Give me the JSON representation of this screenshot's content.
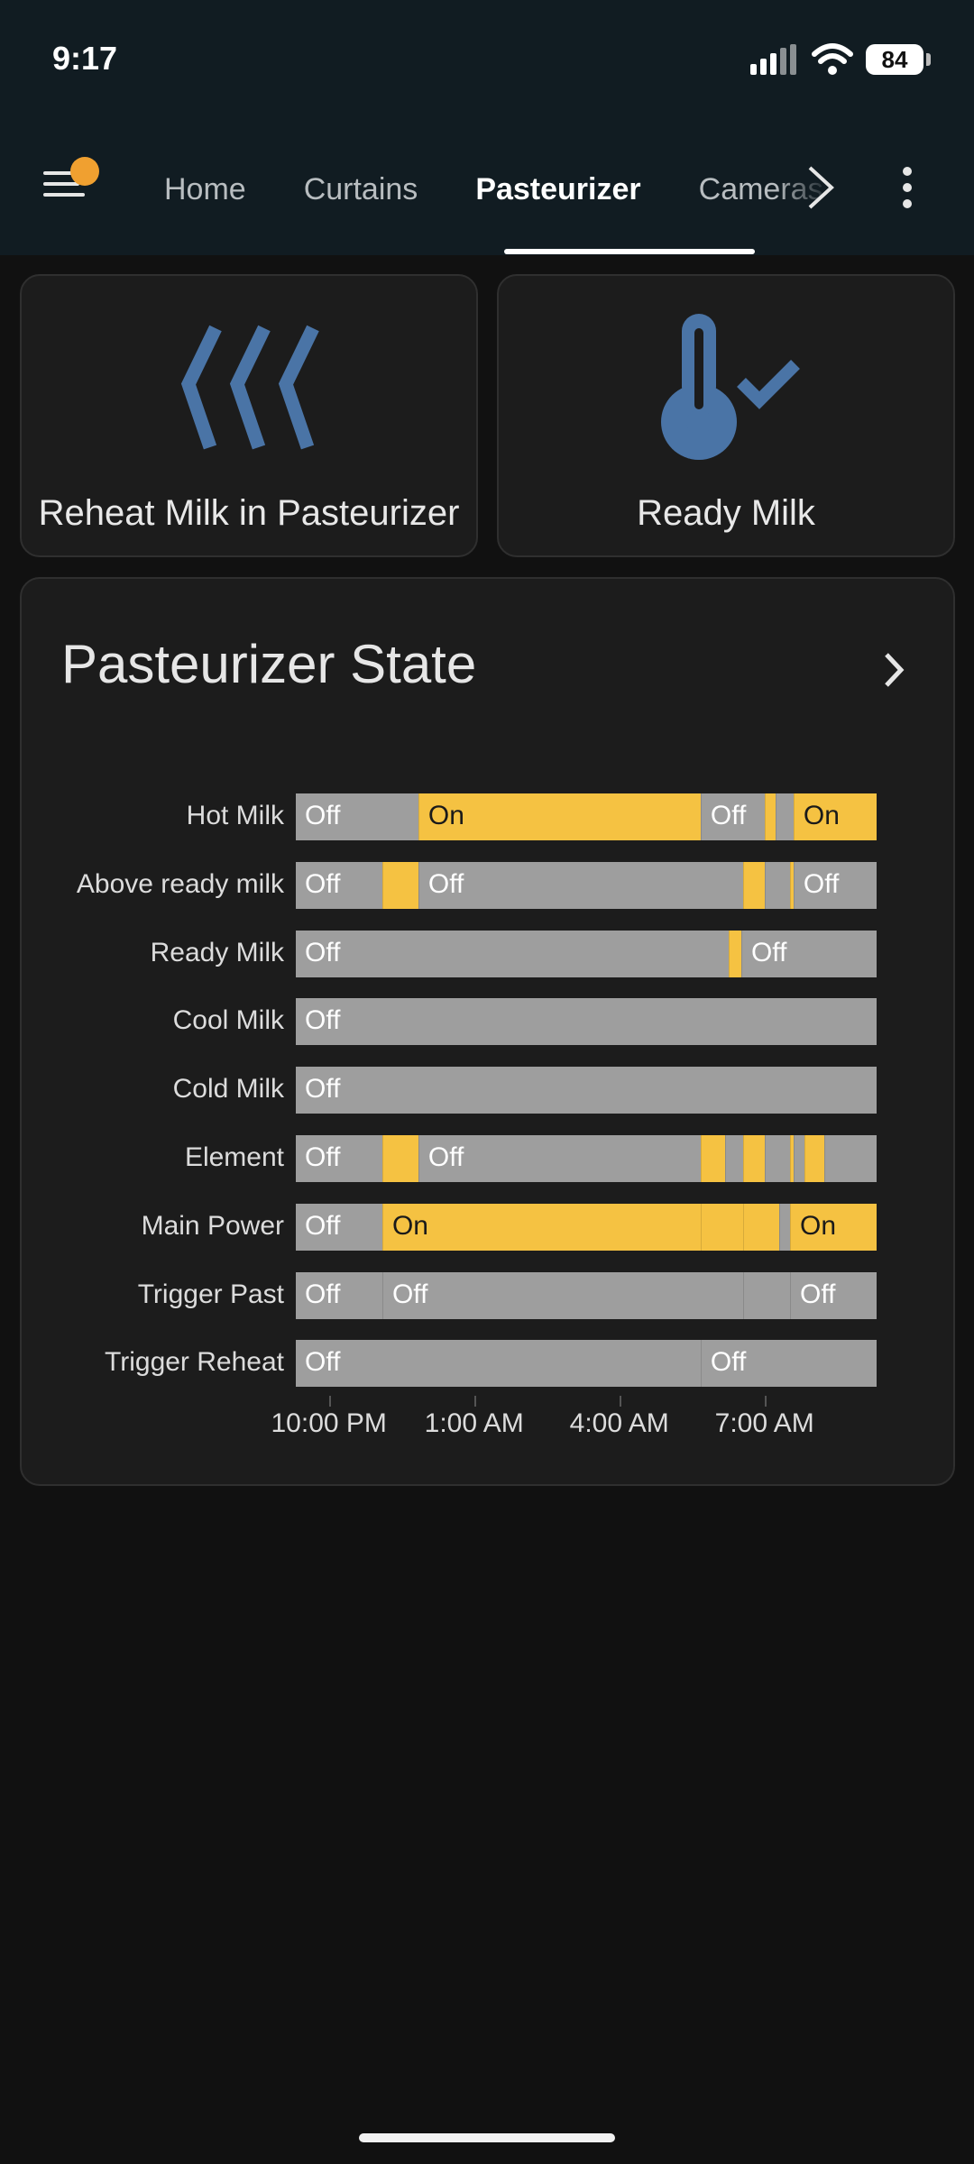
{
  "status_bar": {
    "time": "9:17",
    "battery": "84"
  },
  "nav": {
    "tabs": [
      {
        "label": "Home",
        "active": false
      },
      {
        "label": "Curtains",
        "active": false
      },
      {
        "label": "Pasteurizer",
        "active": true
      },
      {
        "label": "Cameras",
        "active": false
      }
    ]
  },
  "tiles": [
    {
      "label": "Reheat Milk in Pasteurizer",
      "icon": "heat-wave-icon"
    },
    {
      "label": "Ready Milk",
      "icon": "thermometer-check-icon"
    }
  ],
  "colors": {
    "on": "#f5c242",
    "off": "#9e9e9e",
    "icon_blue": "#4a74a6",
    "accent_dot": "#f0a030"
  },
  "history": {
    "title": "Pasteurizer State",
    "x_ticks": [
      {
        "label": "10:00 PM",
        "frac": 0.057
      },
      {
        "label": "1:00 AM",
        "frac": 0.307
      },
      {
        "label": "4:00 AM",
        "frac": 0.557
      },
      {
        "label": "7:00 AM",
        "frac": 0.807
      }
    ],
    "rows": [
      {
        "name": "Hot Milk",
        "segments": [
          {
            "state": "off",
            "start": 0.0,
            "end": 0.211,
            "label": "Off"
          },
          {
            "state": "on",
            "start": 0.211,
            "end": 0.697,
            "label": "On"
          },
          {
            "state": "off",
            "start": 0.697,
            "end": 0.807,
            "label": "Off"
          },
          {
            "state": "on",
            "start": 0.807,
            "end": 0.826
          },
          {
            "state": "off",
            "start": 0.826,
            "end": 0.857
          },
          {
            "state": "on",
            "start": 0.857,
            "end": 1.0,
            "label": "On"
          }
        ]
      },
      {
        "name": "Above ready milk",
        "segments": [
          {
            "state": "off",
            "start": 0.0,
            "end": 0.149,
            "label": "Off"
          },
          {
            "state": "on",
            "start": 0.149,
            "end": 0.211
          },
          {
            "state": "off",
            "start": 0.211,
            "end": 0.77,
            "label": "Off"
          },
          {
            "state": "on",
            "start": 0.77,
            "end": 0.807
          },
          {
            "state": "off",
            "start": 0.807,
            "end": 0.851
          },
          {
            "state": "on",
            "start": 0.851,
            "end": 0.857
          },
          {
            "state": "off",
            "start": 0.857,
            "end": 1.0,
            "label": "Off"
          }
        ]
      },
      {
        "name": "Ready Milk",
        "segments": [
          {
            "state": "off",
            "start": 0.0,
            "end": 0.745,
            "label": "Off"
          },
          {
            "state": "on",
            "start": 0.745,
            "end": 0.767
          },
          {
            "state": "off",
            "start": 0.767,
            "end": 1.0,
            "label": "Off"
          }
        ]
      },
      {
        "name": "Cool Milk",
        "segments": [
          {
            "state": "off",
            "start": 0.0,
            "end": 1.0,
            "label": "Off"
          }
        ]
      },
      {
        "name": "Cold Milk",
        "segments": [
          {
            "state": "off",
            "start": 0.0,
            "end": 1.0,
            "label": "Off"
          }
        ]
      },
      {
        "name": "Element",
        "segments": [
          {
            "state": "off",
            "start": 0.0,
            "end": 0.149,
            "label": "Off"
          },
          {
            "state": "on",
            "start": 0.149,
            "end": 0.211
          },
          {
            "state": "off",
            "start": 0.211,
            "end": 0.697,
            "label": "Off"
          },
          {
            "state": "on",
            "start": 0.697,
            "end": 0.739
          },
          {
            "state": "off",
            "start": 0.739,
            "end": 0.77
          },
          {
            "state": "on",
            "start": 0.77,
            "end": 0.807
          },
          {
            "state": "off",
            "start": 0.807,
            "end": 0.851
          },
          {
            "state": "on",
            "start": 0.851,
            "end": 0.857
          },
          {
            "state": "off",
            "start": 0.857,
            "end": 0.876
          },
          {
            "state": "on",
            "start": 0.876,
            "end": 0.91
          },
          {
            "state": "off",
            "start": 0.91,
            "end": 1.0
          }
        ]
      },
      {
        "name": "Main Power",
        "segments": [
          {
            "state": "off",
            "start": 0.0,
            "end": 0.149,
            "label": "Off"
          },
          {
            "state": "on",
            "start": 0.149,
            "end": 0.697,
            "label": "On"
          },
          {
            "state": "on",
            "start": 0.697,
            "end": 0.77
          },
          {
            "state": "on",
            "start": 0.77,
            "end": 0.832
          },
          {
            "state": "off",
            "start": 0.832,
            "end": 0.851
          },
          {
            "state": "on",
            "start": 0.851,
            "end": 1.0,
            "label": "On"
          }
        ]
      },
      {
        "name": "Trigger Past",
        "segments": [
          {
            "state": "off",
            "start": 0.0,
            "end": 0.149,
            "label": "Off"
          },
          {
            "state": "off",
            "start": 0.149,
            "end": 0.77,
            "label": "Off"
          },
          {
            "state": "off",
            "start": 0.77,
            "end": 0.851
          },
          {
            "state": "off",
            "start": 0.851,
            "end": 1.0,
            "label": "Off"
          }
        ]
      },
      {
        "name": "Trigger Reheat",
        "segments": [
          {
            "state": "off",
            "start": 0.0,
            "end": 0.697,
            "label": "Off"
          },
          {
            "state": "off",
            "start": 0.697,
            "end": 1.0,
            "label": "Off"
          }
        ]
      }
    ]
  }
}
